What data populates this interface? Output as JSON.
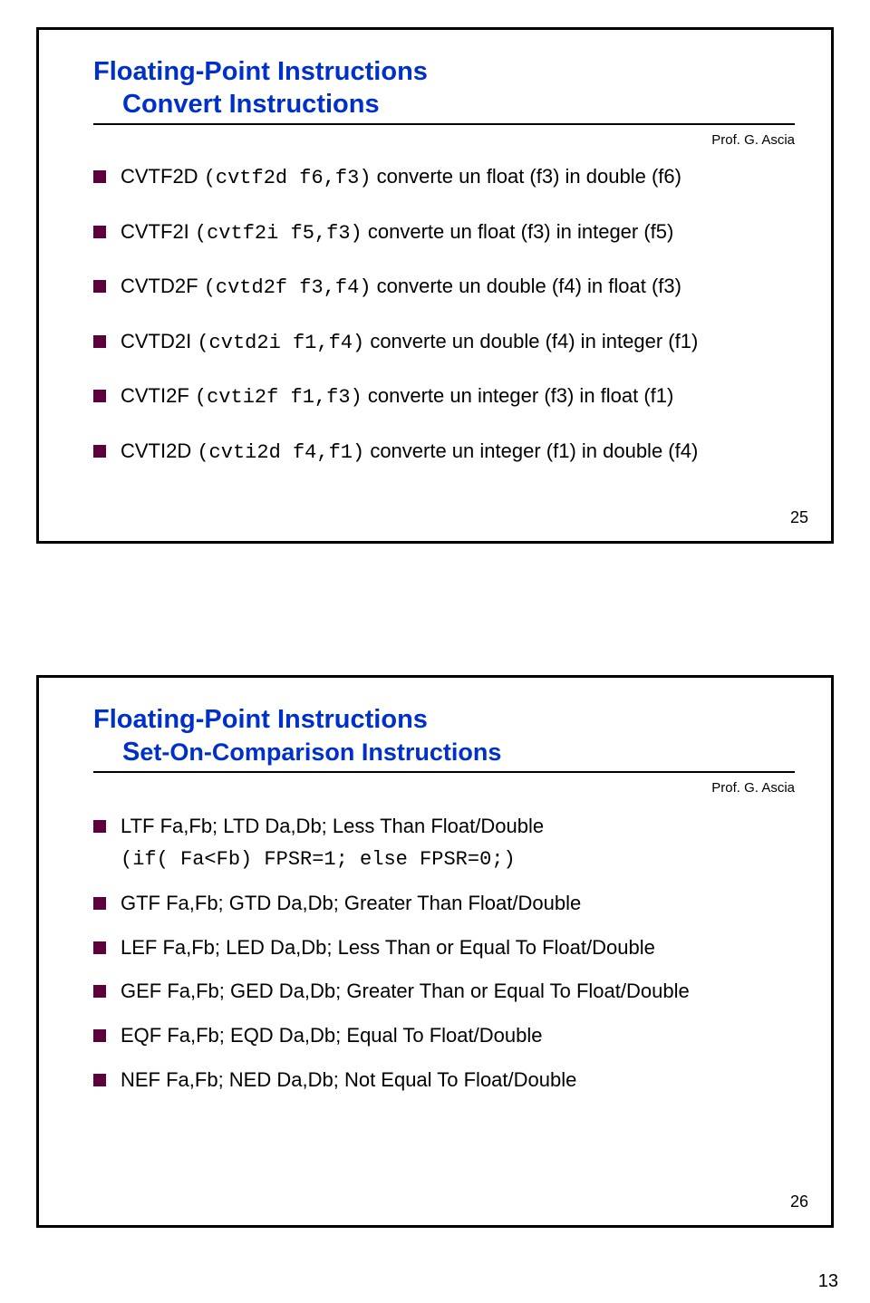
{
  "slide1": {
    "title": "Floating-Point Instructions",
    "subtitle": "Convert Instructions",
    "prof": "Prof. G. Ascia",
    "items": [
      {
        "code": "CVTF2D (cvtf2d f6,f3)",
        "desc": "  converte un float (f3) in double (f6)"
      },
      {
        "code": "CVTF2I (cvtf2i f5,f3)",
        "desc": "   converte un float (f3) in integer (f5)"
      },
      {
        "code": "CVTD2F (cvtd2f f3,f4)",
        "desc": " converte un double (f4) in float (f3)"
      },
      {
        "code": "CVTD2I (cvtd2i f1,f4)",
        "desc": " converte un double (f4) in integer (f1)"
      },
      {
        "code": "CVTI2F (cvti2f f1,f3)",
        "desc": " converte un integer (f3) in float (f1)"
      },
      {
        "code": "CVTI2D (cvti2d f4,f1)",
        "desc": " converte un integer (f1) in double (f4)"
      }
    ],
    "num": "25"
  },
  "slide2": {
    "title": "Floating-Point Instructions",
    "subtitle": "Set-On-Comparison Instructions",
    "prof": "Prof. G. Ascia",
    "items": [
      {
        "txt": "LTF Fa,Fb;  LTD Da,Db;       Less Than Float/Double"
      },
      {
        "txt": "(if( Fa<Fb) FPSR=1; else FPSR=0;)",
        "mono": true,
        "nobul": true
      },
      {
        "txt": "GTF Fa,Fb;  GTD Da,Db;      Greater Than Float/Double"
      },
      {
        "txt": "LEF Fa,Fb; LED Da,Db;     Less Than or Equal To Float/Double"
      },
      {
        "txt": "GEF Fa,Fb; GED Da,Db;    Greater Than or Equal To Float/Double"
      },
      {
        "txt": "EQF Fa,Fb;  EQD Da,Db;      Equal To Float/Double"
      },
      {
        "txt": "NEF Fa,Fb; NED Da,Db;       Not Equal To Float/Double"
      }
    ],
    "num": "26"
  },
  "pagenum": "13"
}
